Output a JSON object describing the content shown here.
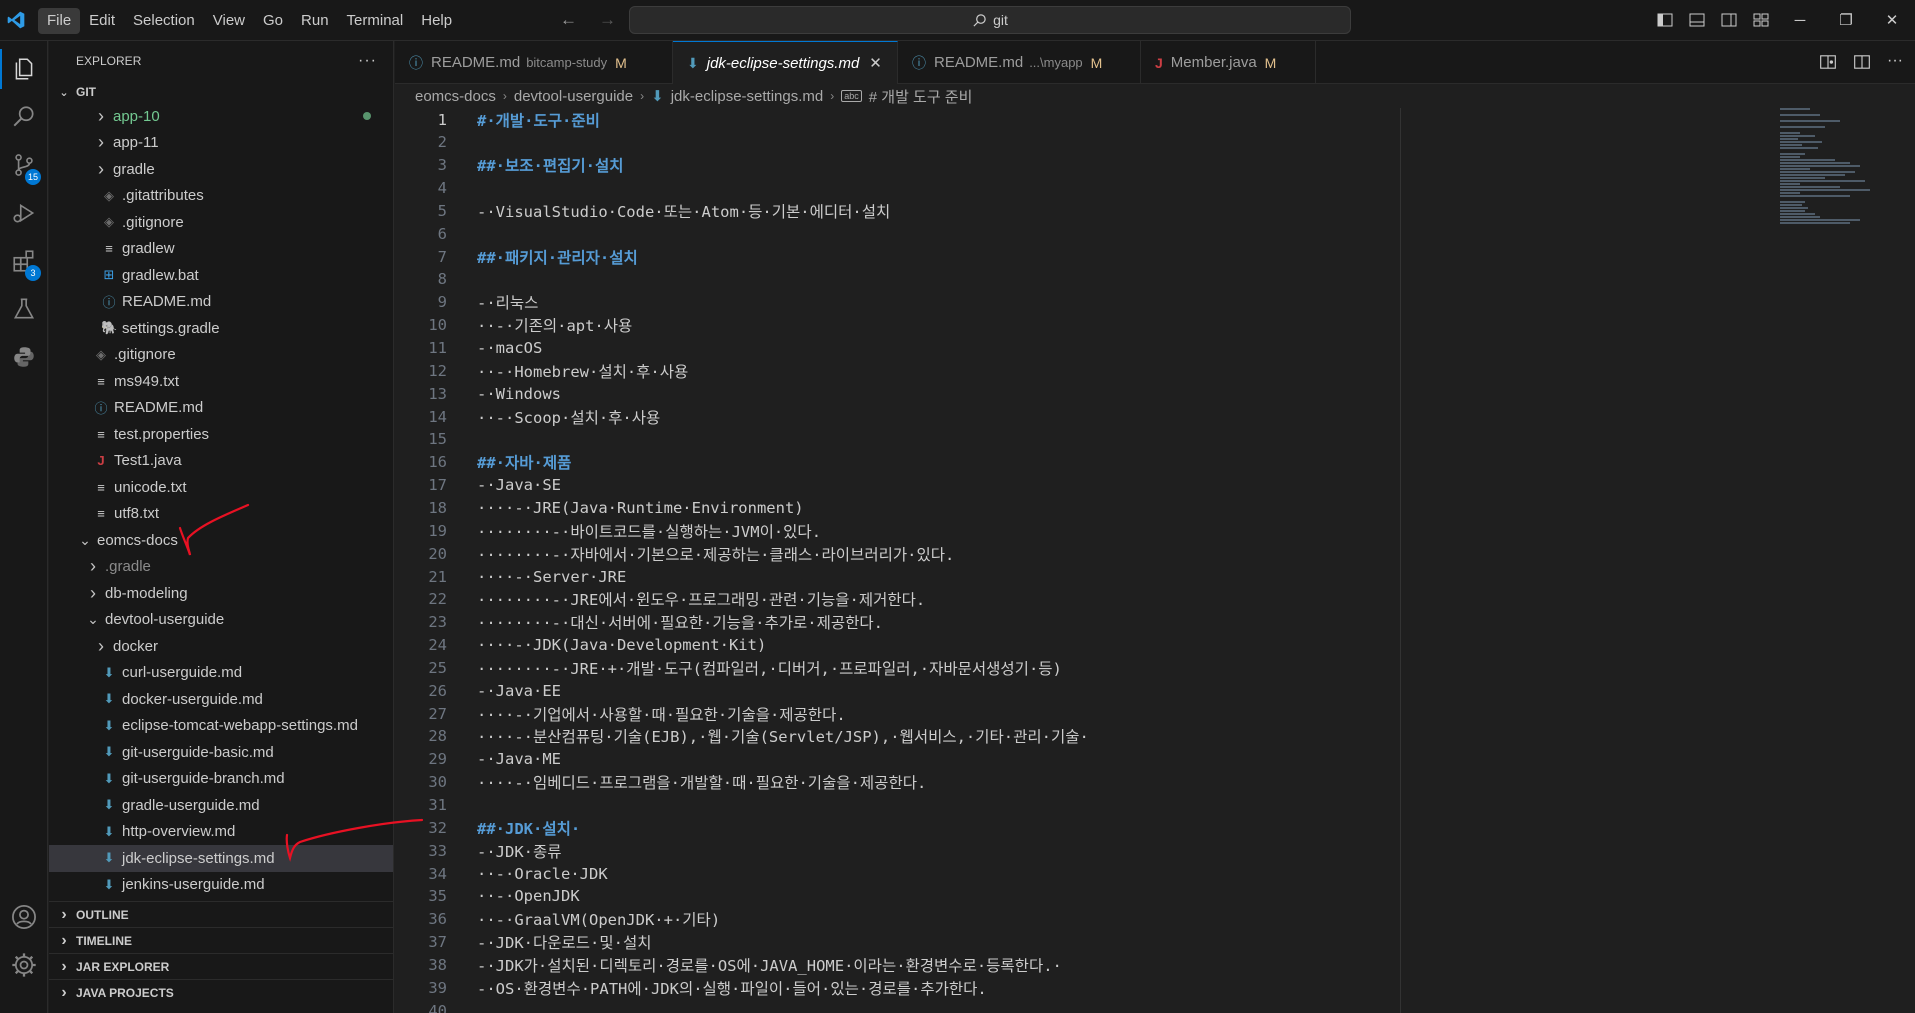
{
  "menu": [
    "File",
    "Edit",
    "Selection",
    "View",
    "Go",
    "Run",
    "Terminal",
    "Help"
  ],
  "search": {
    "label": "git"
  },
  "activity": {
    "scm_badge": "15",
    "extensions_badge": "3"
  },
  "explorer": {
    "header": "EXPLORER",
    "root": "GIT",
    "items": [
      {
        "label": "app-10",
        "depth": 1,
        "kind": "folder-closed",
        "status": "green"
      },
      {
        "label": "app-11",
        "depth": 1,
        "kind": "folder-closed"
      },
      {
        "label": "gradle",
        "depth": 1,
        "kind": "folder-closed"
      },
      {
        "label": ".gitattributes",
        "depth": 1,
        "kind": "git-icon"
      },
      {
        "label": ".gitignore",
        "depth": 1,
        "kind": "git-icon"
      },
      {
        "label": "gradlew",
        "depth": 1,
        "kind": "lines-icon"
      },
      {
        "label": "gradlew.bat",
        "depth": 1,
        "kind": "windows-icon"
      },
      {
        "label": "README.md",
        "depth": 1,
        "kind": "info-icon"
      },
      {
        "label": "settings.gradle",
        "depth": 1,
        "kind": "gradle-icon"
      },
      {
        "label": ".gitignore",
        "depth": 0,
        "kind": "git-icon"
      },
      {
        "label": "ms949.txt",
        "depth": 0,
        "kind": "lines-icon"
      },
      {
        "label": "README.md",
        "depth": 0,
        "kind": "info-icon"
      },
      {
        "label": "test.properties",
        "depth": 0,
        "kind": "lines-icon"
      },
      {
        "label": "Test1.java",
        "depth": 0,
        "kind": "java-icon"
      },
      {
        "label": "unicode.txt",
        "depth": 0,
        "kind": "lines-icon"
      },
      {
        "label": "utf8.txt",
        "depth": 0,
        "kind": "lines-icon"
      },
      {
        "label": "eomcs-docs",
        "depth": -1,
        "kind": "folder-open"
      },
      {
        "label": ".gradle",
        "depth": 0,
        "kind": "folder-closed",
        "dim": true
      },
      {
        "label": "db-modeling",
        "depth": 0,
        "kind": "folder-closed"
      },
      {
        "label": "devtool-userguide",
        "depth": 0,
        "kind": "folder-open"
      },
      {
        "label": "docker",
        "depth": 1,
        "kind": "folder-closed"
      },
      {
        "label": "curl-userguide.md",
        "depth": 1,
        "kind": "md-icon"
      },
      {
        "label": "docker-userguide.md",
        "depth": 1,
        "kind": "md-icon"
      },
      {
        "label": "eclipse-tomcat-webapp-settings.md",
        "depth": 1,
        "kind": "md-icon"
      },
      {
        "label": "git-userguide-basic.md",
        "depth": 1,
        "kind": "md-icon"
      },
      {
        "label": "git-userguide-branch.md",
        "depth": 1,
        "kind": "md-icon"
      },
      {
        "label": "gradle-userguide.md",
        "depth": 1,
        "kind": "md-icon"
      },
      {
        "label": "http-overview.md",
        "depth": 1,
        "kind": "md-icon"
      },
      {
        "label": "jdk-eclipse-settings.md",
        "depth": 1,
        "kind": "md-icon",
        "selected": true
      },
      {
        "label": "jenkins-userguide.md",
        "depth": 1,
        "kind": "md-icon"
      }
    ],
    "sections": [
      "OUTLINE",
      "TIMELINE",
      "JAR EXPLORER",
      "JAVA PROJECTS"
    ]
  },
  "tabs": [
    {
      "label": "README.md",
      "desc": "bitcamp-study",
      "modified": "M",
      "icon": "info-icon"
    },
    {
      "label": "jdk-eclipse-settings.md",
      "desc": "",
      "modified": "",
      "icon": "md-icon",
      "active": true
    },
    {
      "label": "README.md",
      "desc": "...\\myapp",
      "modified": "M",
      "icon": "info-icon"
    },
    {
      "label": "Member.java",
      "desc": "",
      "modified": "M",
      "icon": "java-icon"
    }
  ],
  "breadcrumb": [
    "eomcs-docs",
    "devtool-userguide",
    "jdk-eclipse-settings.md",
    "# 개발 도구 준비"
  ],
  "code": [
    {
      "n": "1",
      "t": "#·개발·도구·준비",
      "h": true
    },
    {
      "n": "2",
      "t": ""
    },
    {
      "n": "3",
      "t": "##·보조·편집기·설치",
      "h": true
    },
    {
      "n": "4",
      "t": ""
    },
    {
      "n": "5",
      "t": "-·VisualStudio·Code·또는·Atom·등·기본·에디터·설치"
    },
    {
      "n": "6",
      "t": ""
    },
    {
      "n": "7",
      "t": "##·패키지·관리자·설치",
      "h": true
    },
    {
      "n": "8",
      "t": ""
    },
    {
      "n": "9",
      "t": "-·리눅스"
    },
    {
      "n": "10",
      "t": "··-·기존의·apt·사용"
    },
    {
      "n": "11",
      "t": "-·macOS"
    },
    {
      "n": "12",
      "t": "··-·Homebrew·설치·후·사용"
    },
    {
      "n": "13",
      "t": "-·Windows"
    },
    {
      "n": "14",
      "t": "··-·Scoop·설치·후·사용"
    },
    {
      "n": "15",
      "t": ""
    },
    {
      "n": "16",
      "t": "##·자바·제품",
      "h": true
    },
    {
      "n": "17",
      "t": "-·Java·SE"
    },
    {
      "n": "18",
      "t": "····-·JRE(Java·Runtime·Environment)"
    },
    {
      "n": "19",
      "t": "········-·바이트코드를·실행하는·JVM이·있다."
    },
    {
      "n": "20",
      "t": "········-·자바에서·기본으로·제공하는·클래스·라이브러리가·있다."
    },
    {
      "n": "21",
      "t": "····-·Server·JRE"
    },
    {
      "n": "22",
      "t": "········-·JRE에서·윈도우·프로그래밍·관련·기능을·제거한다."
    },
    {
      "n": "23",
      "t": "········-·대신·서버에·필요한·기능을·추가로·제공한다."
    },
    {
      "n": "24",
      "t": "····-·JDK(Java·Development·Kit)"
    },
    {
      "n": "25",
      "t": "········-·JRE·+·개발·도구(컴파일러,·디버거,·프로파일러,·자바문서생성기·등)"
    },
    {
      "n": "26",
      "t": "-·Java·EE"
    },
    {
      "n": "27",
      "t": "····-·기업에서·사용할·때·필요한·기술을·제공한다."
    },
    {
      "n": "28",
      "t": "····-·분산컴퓨팅·기술(EJB),·웹·기술(Servlet/JSP),·웹서비스,·기타·관리·기술·"
    },
    {
      "n": "29",
      "t": "-·Java·ME"
    },
    {
      "n": "30",
      "t": "····-·임베디드·프로그램을·개발할·때·필요한·기술을·제공한다."
    },
    {
      "n": "31",
      "t": ""
    },
    {
      "n": "32",
      "t": "##·JDK·설치·",
      "h": true
    },
    {
      "n": "33",
      "t": "-·JDK·종류"
    },
    {
      "n": "34",
      "t": "··-·Oracle·JDK"
    },
    {
      "n": "35",
      "t": "··-·OpenJDK"
    },
    {
      "n": "36",
      "t": "··-·GraalVM(OpenJDK·+·기타)"
    },
    {
      "n": "37",
      "t": "-·JDK·다운로드·및·설치"
    },
    {
      "n": "38",
      "t": "-·JDK가·설치된·디렉토리·경로를·OS에·JAVA_HOME·이라는·환경변수로·등록한다.·"
    },
    {
      "n": "39",
      "t": "-·OS·환경변수·PATH에·JDK의·실행·파일이·들어·있는·경로를·추가한다."
    },
    {
      "n": "40",
      "t": ""
    }
  ],
  "colors": {
    "accent": "#0078d4",
    "heading": "#569cd6",
    "modified": "#e2c08d",
    "annotation": "#e81123"
  }
}
